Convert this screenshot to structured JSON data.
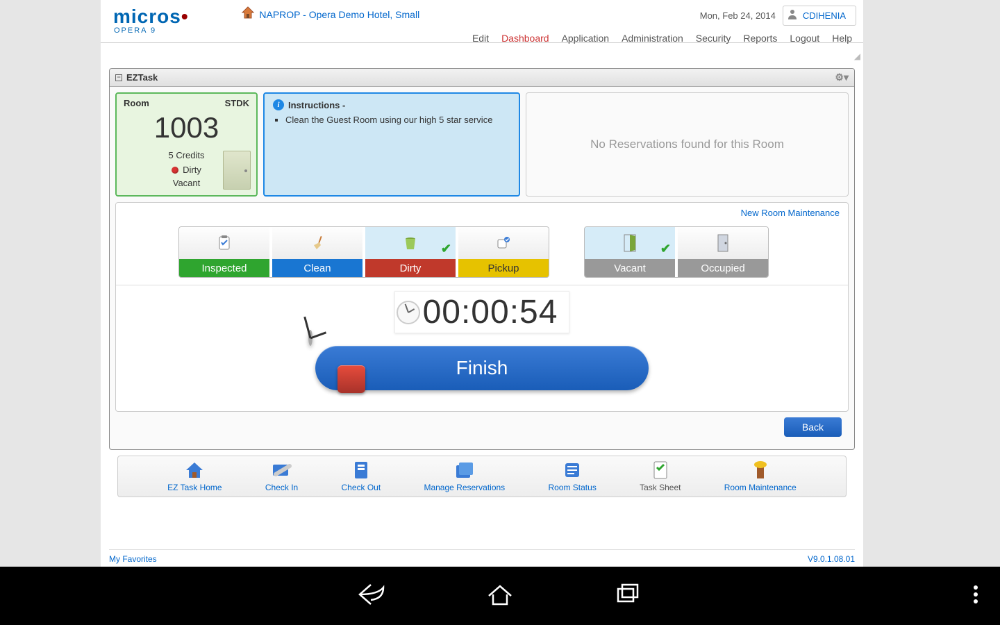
{
  "header": {
    "logo": "micros",
    "logo_sub": "OPERA 9",
    "property": "NAPROP - Opera Demo Hotel, Small",
    "date": "Mon, Feb 24, 2014",
    "user": "CDIHENIA"
  },
  "nav": {
    "edit": "Edit",
    "dashboard": "Dashboard",
    "application": "Application",
    "administration": "Administration",
    "security": "Security",
    "reports": "Reports",
    "logout": "Logout",
    "help": "Help"
  },
  "widget": {
    "title": "EZTask",
    "room": {
      "label": "Room",
      "type": "STDK",
      "number": "1003",
      "credits": "5 Credits",
      "cleanStatus": "Dirty",
      "occStatus": "Vacant"
    },
    "instructions": {
      "label": "Instructions -",
      "items": [
        "Clean the Guest Room using our high 5 star service"
      ]
    },
    "reservations": "No Reservations found for this Room",
    "maintenanceLink": "New Room Maintenance",
    "statusButtons": {
      "inspected": "Inspected",
      "clean": "Clean",
      "dirty": "Dirty",
      "pickup": "Pickup",
      "vacant": "Vacant",
      "occupied": "Occupied"
    },
    "timer": "00:00:54",
    "finish": "Finish",
    "back": "Back"
  },
  "toolbar": {
    "ezTaskHome": "EZ Task Home",
    "checkIn": "Check In",
    "checkOut": "Check Out",
    "manageReservations": "Manage Reservations",
    "roomStatus": "Room Status",
    "taskSheet": "Task Sheet",
    "roomMaintenance": "Room Maintenance"
  },
  "footer": {
    "favorites": "My Favorites",
    "version": "V9.0.1.08.01"
  }
}
